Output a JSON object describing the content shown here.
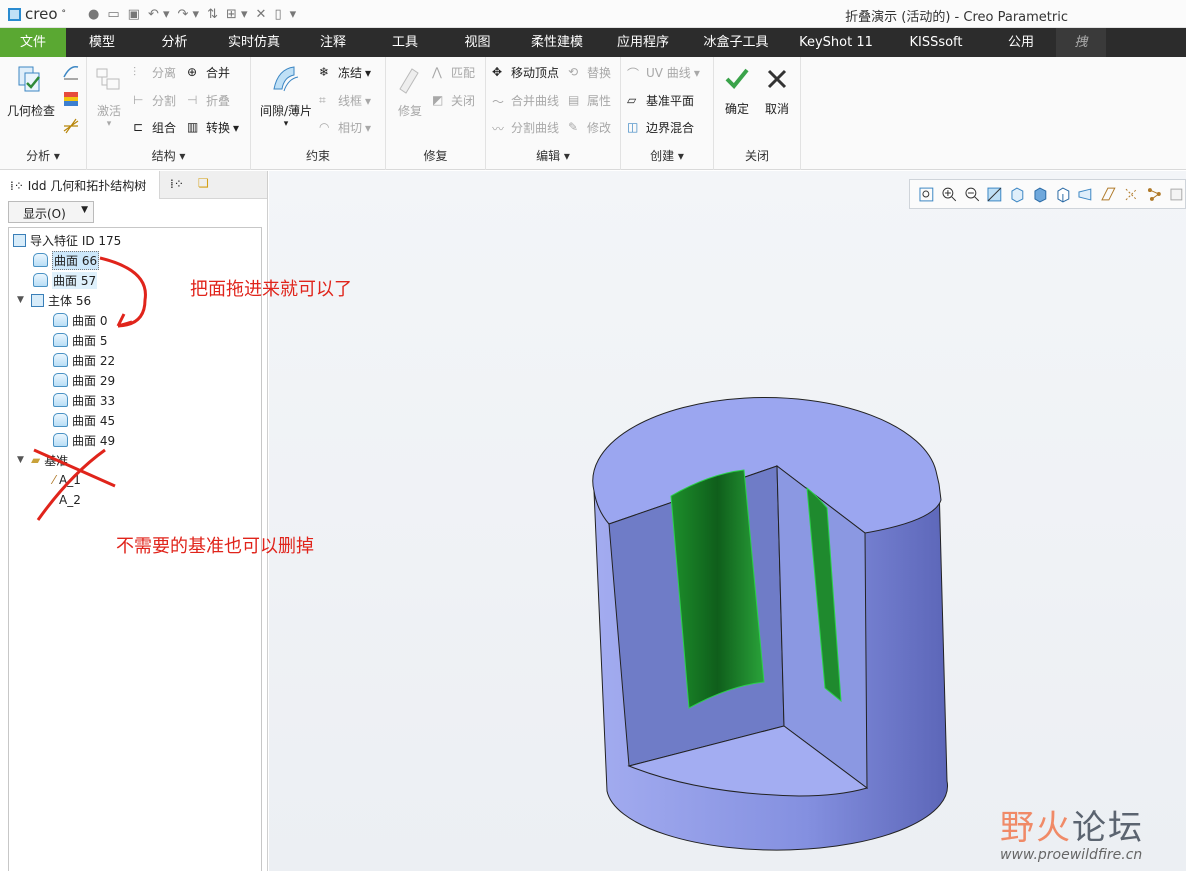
{
  "titlebar": {
    "app_logo": "creo",
    "window_title": "折叠演示 (活动的) - Creo Parametric"
  },
  "menubar": {
    "items": [
      "文件",
      "模型",
      "分析",
      "实时仿真",
      "注释",
      "工具",
      "视图",
      "柔性建模",
      "应用程序",
      "冰盒子工具",
      "KeyShot 11",
      "KISSsoft",
      "公用",
      "拽"
    ]
  },
  "ribbon": {
    "analysis": {
      "label": "分析",
      "geom_check": "几何检查"
    },
    "structure": {
      "label": "结构",
      "activate": "激活",
      "separate": "分离",
      "merge": "合并",
      "split": "分割",
      "fold": "折叠",
      "combine": "组合",
      "convert": "转换"
    },
    "constraints": {
      "label": "约束",
      "gap_sheet": "间隙/薄片",
      "freeze": "冻结",
      "wireframe": "线框",
      "tangent": "相切"
    },
    "repair": {
      "label": "修复",
      "repair": "修复",
      "match": "匹配",
      "close": "关闭"
    },
    "edit": {
      "label": "编辑",
      "move_vertex": "移动顶点",
      "replace": "替换",
      "merge_curves": "合并曲线",
      "properties": "属性",
      "split_curves": "分割曲线",
      "modify": "修改"
    },
    "create": {
      "label": "创建",
      "uv_curve": "UV 曲线",
      "datum_plane": "基准平面",
      "boundary_blend": "边界混合"
    },
    "close": {
      "label": "关闭",
      "ok": "确定",
      "cancel": "取消"
    }
  },
  "panel": {
    "tab_title": "Idd 几何和拓扑结构树",
    "show_button": "显示(O)",
    "tree": {
      "root": "导入特征 ID 175",
      "surface_66": "曲面 66",
      "surface_57": "曲面 57",
      "body": "主体 56",
      "body_surfaces": [
        "曲面 0",
        "曲面 5",
        "曲面 22",
        "曲面 29",
        "曲面 33",
        "曲面 45",
        "曲面 49"
      ],
      "datums": "基准",
      "axes": [
        "A_1",
        "A_2"
      ]
    }
  },
  "annotations": {
    "drag_note": "把面拖进来就可以了",
    "delete_note": "不需要的基准也可以删掉"
  },
  "watermark": {
    "title_part1": "野火",
    "title_part2": "论坛",
    "url": "www.proewildfire.cn"
  },
  "colors": {
    "menu_active": "#5aa832",
    "menubar": "#2c2c2c",
    "model_body": "#8f9ae6",
    "model_green": "#1f8a2e",
    "annotation_red": "#e0241b"
  }
}
